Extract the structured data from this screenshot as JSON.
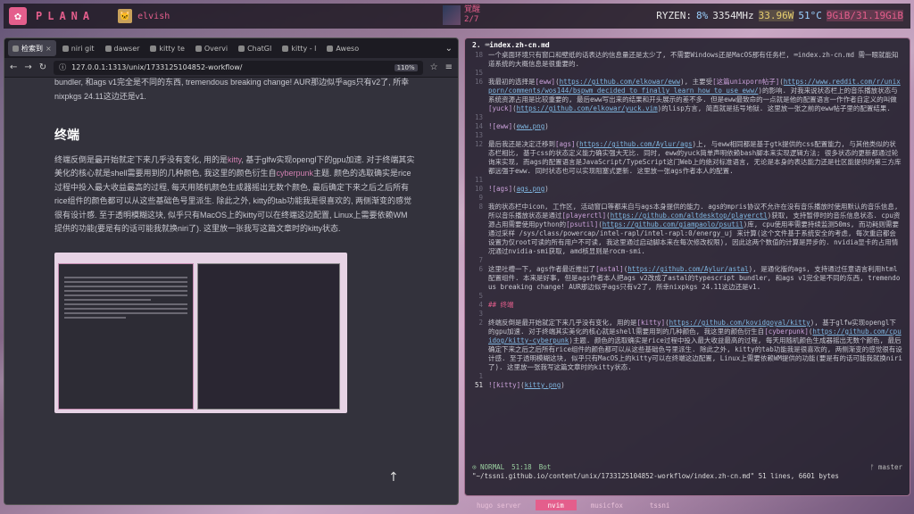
{
  "topbar": {
    "logo_glyph": "✿",
    "brand": "PLANA",
    "user_avatar_glyph": "🐱",
    "user_name": "elvish",
    "media_title": "覚醒",
    "media_track": "2/7",
    "stats": {
      "cpu_label": "RYZEN:",
      "cpu_pct": "8%",
      "cpu_mhz": "3354MHz",
      "power": "33.96W",
      "temp": "51°C",
      "mem": "9GiB/31.19GiB"
    }
  },
  "browser": {
    "tabs": [
      {
        "label": "检索到",
        "active": true
      },
      {
        "label": "niri git",
        "active": false
      },
      {
        "label": "dawser",
        "active": false
      },
      {
        "label": "kitty te",
        "active": false
      },
      {
        "label": "Overvi",
        "active": false
      },
      {
        "label": "ChatGI",
        "active": false
      },
      {
        "label": "kitty - l",
        "active": false
      },
      {
        "label": "Aweso",
        "active": false
      }
    ],
    "tabs_overflow": "⌄",
    "nav": {
      "back": "←",
      "forward": "→",
      "reload": "↻",
      "url": "127.0.0.1:1313/unix/1733125104852-workflow/",
      "zoom": "110%",
      "bookmark": "☆",
      "menu": "≡"
    },
    "page": {
      "p1_before": "bundler, 和ags v1完全是不同的东西, tremendous breaking change! AUR那边似乎ags只有v2了, 所幸nixpkgs 24.11这边还是v1.",
      "heading": "终端",
      "p2_a": "终端反倒是最开始就定下来几乎没有变化, 用的是",
      "p2_link1": "kitty",
      "p2_b": ", 基于glfw实现opengl下的gpu加速. 对于终端其实美化的核心就是shell需要用到的几种颜色, 我这里的颜色衍生自",
      "p2_link2": "cyberpunk",
      "p2_c": "主题. 颜色的选取确实是rice过程中投入最大收益最高的过程, 每天用随机颜色生成器摇出无数个颜色, 最后确定下来之后之后所有rice组件的颜色都可以从这些基础色号里派生. 除此之外, kitty的tab功能我是很喜欢的, 两侧渐变的感觉很有设计感. 至于透明模糊这块, 似乎只有MacOS上的kitty可以在终端这边配置, Linux上需要依赖WM提供的功能(要是有的话可能我就换niri了). 这里放一张我写这篇文章时的kitty状态.",
      "scroll_up_glyph": "↑"
    }
  },
  "terminal": {
    "title": "2. ⌨index.zh-cn.md",
    "lines": [
      {
        "n": "18",
        "t": "一个桌面环境只有窗口和壁纸的话表达的信息量还是太少了, 不需要Windows还是MacOS那有任务栏, ⌨index.zh-cn.md 需一眼就能知道系统的大概信息是很重要的."
      },
      {
        "n": "15",
        "t": ""
      },
      {
        "n": "16",
        "t": "我最初的选择是[eww](https://github.com/elkowar/eww), 主要受[这篇unixporn帖子](https://www.reddit.com/r/unixporn/comments/wos144/bspwm_decided_to_finally_learn_how_to_use_eww/)的影响. 对我来说状态栏上的音乐播放状态与系统资源占用是比较重要的, 最后eww写出来的结果和开头展示的差不多. 但是eww最致命的一点就是他的配置语言一作作者自定义的叫做[yuck](https://github.com/elkowar/yuck.vim)的lisp方言, 简直就是括号地狱. 这里放一张之前的eww帖子里的配置结果."
      },
      {
        "n": "13",
        "t": ""
      },
      {
        "n": "14",
        "t": "![eww](eww.png)"
      },
      {
        "n": "13",
        "t": ""
      },
      {
        "n": "12",
        "t": "最后我还是决定迁移到[ags](https://github.com/Aylur/ags)上, 与eww相同都是基于gtk提供的css配置能力, 与其他类似的状态栏相比, 基于css的状态定义能力确实强大无比. 同时, eww的yuck简单声明依赖bash脚本来实现逻辑方法; 很多状态的更新都通过轮询来实现, 而ags的配置语言是JavaScript/TypeScript这门Web上的绝对标准语言, 无论是本身的表达能力还是社区能提供的第三方库都远强于eww. 同时状态也可以实现阻塞式更新. 这里放一张ags作者本人的配置."
      },
      {
        "n": "11",
        "t": ""
      },
      {
        "n": "10",
        "t": "![ags](ags.png)"
      },
      {
        "n": "9",
        "t": ""
      },
      {
        "n": "8",
        "t": "我的状态栏中icon, 工作区, 活动窗口等都来自与ags本身提供的能力. ags的mpris协议不允许在没有音乐播放时使用默认的音乐信息, 所以音乐播放状态是通过[playerctl](https://github.com/altdesktop/playerctl)获取, 支持暂停时的音乐信息状态. cpu资源占用需要使用python的[psutil](https://github.com/giampaolo/psutil)库, cpu使用率需要持续监测50ms, 而功耗则需要通过采样 /sys/class/powercap/intel-rapl/intel-rapl:0/energy_uj 来计算(这个文件基于系统安全的考虑, 每次重启都会设置为仅root可读的所有用户不可读, 我这里通过启动脚本来在每次修改权限), 因此这两个数值的计算是异步的. nvidia显卡的占用情况通过nvidia-smi获取, amd核显则是rocm-smi."
      },
      {
        "n": "7",
        "t": ""
      },
      {
        "n": "6",
        "t": "这里吐槽一下, ags作者最近推出了[astal](https://github.com/Aylur/astal), 是通化版的ags, 支持通过任意语言利用html配置组件. 本来是好事, 但是ags作者本人把ags v2改成了astal的typescript bundler, 和ags v1完全是不同的东西, tremendous breaking change! AUR那边似乎ags只有v2了, 所幸nixpkgs 24.11这边还是v1."
      },
      {
        "n": "5",
        "t": ""
      },
      {
        "n": "4",
        "t": "## 终端"
      },
      {
        "n": "3",
        "t": ""
      },
      {
        "n": "2",
        "t": "终端反倒是最开始就定下来几乎没有变化, 用的是[kitty](https://github.com/kovidgoyal/kitty), 基于glfw实现opengl下的gpu加速. 对于终端其实美化的核心就是shell需要用到的几种颜色, 我这里的颜色衍生自[cyberpunk](https://github.com/cpuidog/kitty-cyberpunk)主题. 颜色的选取确实是rice过程中投入最大收益最高的过程, 每天用随机颜色生成器摇出无数个颜色, 最后确定下来之后之后所有rice组件的颜色都可以从这些基础色号里派生. 除此之外, kitty的tab功能我是很喜欢的, 两侧渐变的感觉很有设计感. 至于透明模糊这块, 似乎只有MacOS上的kitty可以在终端这边配置, Linux上需要依赖WM提供的功能(要是有的话可能我就换niri了). 这里放一张我写这篇文章时的kitty状态."
      },
      {
        "n": "1",
        "t": ""
      },
      {
        "n": "51",
        "t": "![kitty](kitty.png)"
      }
    ],
    "status": {
      "mode": "⊙ NORMAL",
      "pos": "51:18",
      "scroll": "Bot",
      "branch": "ᚠ master"
    },
    "cmdline": "\"~/tssni.github.io/content/unix/1733125104852-workflow/index.zh-cn.md\" 51 lines, 6601 bytes"
  },
  "tmux": {
    "items": [
      {
        "label": "hugo server",
        "active": false
      },
      {
        "label": "nvim",
        "active": true
      },
      {
        "label": "musicfox",
        "active": false
      },
      {
        "label": "tssni",
        "active": false
      }
    ]
  },
  "colors": {
    "accent": "#e45e8c",
    "link": "#d07fb0",
    "url": "#7fb6e0"
  }
}
